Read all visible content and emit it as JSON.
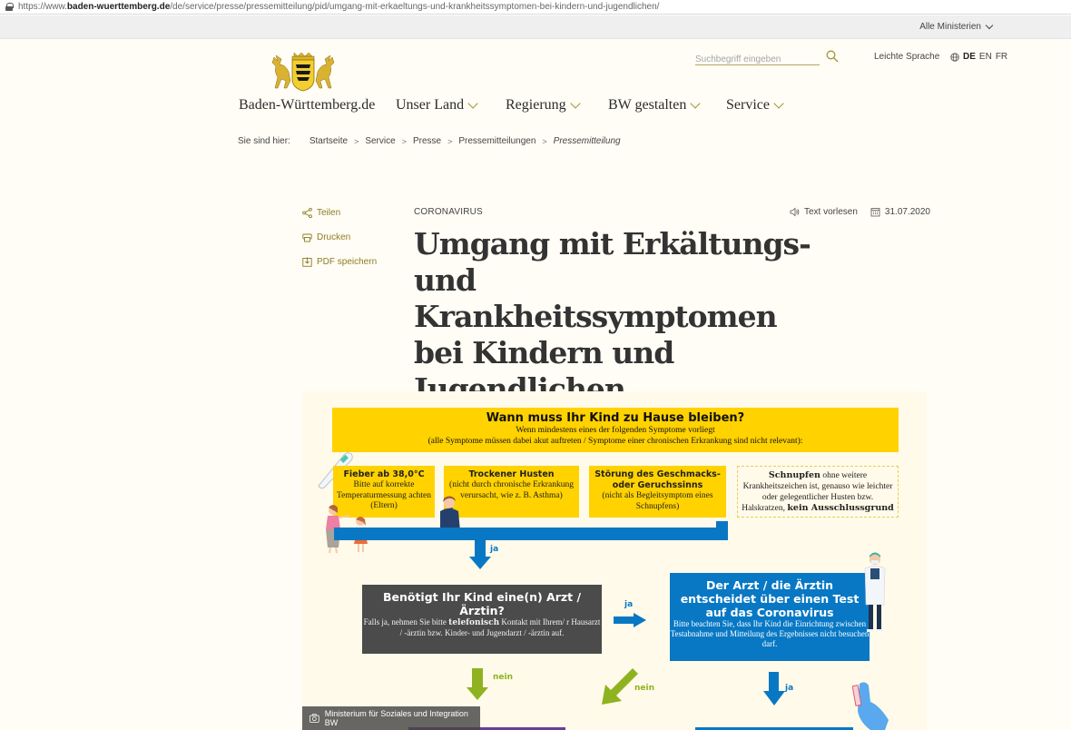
{
  "browser": {
    "url_prefix": "https://www.",
    "url_domain": "baden-wuerttemberg.de",
    "url_path": "/de/service/presse/pressemitteilung/pid/umgang-mit-erkaeltungs-und-krankheitssymptomen-bei-kindern-und-jugendlichen/"
  },
  "topbar": {
    "ministries_label": "Alle Ministerien"
  },
  "header": {
    "site_name": "Baden-Württemberg.de",
    "logo_icon": "coat-of-arms-icon",
    "search_placeholder": "Suchbegriff eingeben",
    "leichte_sprache": "Leichte Sprache",
    "languages": [
      "DE",
      "EN",
      "FR"
    ],
    "active_language": "DE",
    "nav": [
      {
        "label": "Unser Land"
      },
      {
        "label": "Regierung"
      },
      {
        "label": "BW gestalten"
      },
      {
        "label": "Service"
      }
    ]
  },
  "breadcrumb": {
    "label": "Sie sind hier:",
    "items": [
      "Startseite",
      "Service",
      "Presse",
      "Pressemitteilungen"
    ],
    "current": "Pressemitteilung"
  },
  "actions": [
    {
      "label": "Teilen",
      "icon": "share-icon"
    },
    {
      "label": "Drucken",
      "icon": "print-icon"
    },
    {
      "label": "PDF speichern",
      "icon": "download-icon"
    }
  ],
  "article": {
    "category": "CORONAVIRUS",
    "read_aloud": "Text vorlesen",
    "date": "31.07.2020",
    "title": "Umgang mit Erkältungs- und Krankheitssymptomen bei Kindern und Jugendlichen"
  },
  "infographic": {
    "header_title": "Wann muss Ihr Kind zu Hause bleiben?",
    "header_line1": "Wenn mindestens eines der folgenden Symptome vorliegt",
    "header_line2": "(alle Symptome müssen dabei akut auftreten / Symptome einer chronischen Erkrankung sind nicht relevant):",
    "symptoms": [
      {
        "title": "Fieber ab 38,0°C",
        "text": "Bitte auf korrekte Temperaturmessung achten (Eltern)"
      },
      {
        "title": "Trockener Husten",
        "text": "(nicht durch chronische Erkrankung verursacht, wie z. B. Asthma)"
      },
      {
        "title": "Störung des Geschmacks- oder Geruchssinns",
        "text": "(nicht als Begleitsymptom eines Schnupfens)"
      }
    ],
    "note": {
      "bold_start": "Schnupfen",
      "text": " ohne weitere Krankheitszeichen ist, genauso wie leichter oder gelegentlicher Husten bzw. Halskratzen, ",
      "bold_end": "kein Ausschlussgrund"
    },
    "yes": "ja",
    "no": "nein",
    "question": {
      "title": "Benötigt Ihr Kind eine(n) Arzt / Ärztin?",
      "text_before": "Falls ja, nehmen Sie bitte ",
      "text_bold": "telefonisch",
      "text_after": " Kontakt mit Ihrem/ r Hausarzt / -ärztin bzw. Kinder- und Jugendarzt / -ärztin auf."
    },
    "doctor": {
      "title": "Der Arzt / die Ärztin entscheidet über einen Test auf das Coronavirus",
      "text": "Bitte beachten Sie, dass Ihr Kind die Einrichtung zwischen Testabnahme und Mitteilung des Ergebnisses nicht besuchen darf."
    },
    "credit": "Ministerium für Soziales und Integration BW"
  },
  "colors": {
    "accent_gold": "#8f7c24",
    "yellow": "#ffd200",
    "blue": "#0878c4",
    "green": "#8fb320",
    "dark_box": "#4b4b4b",
    "purple": "#6a3f93",
    "page_bg": "#fffdf5"
  }
}
